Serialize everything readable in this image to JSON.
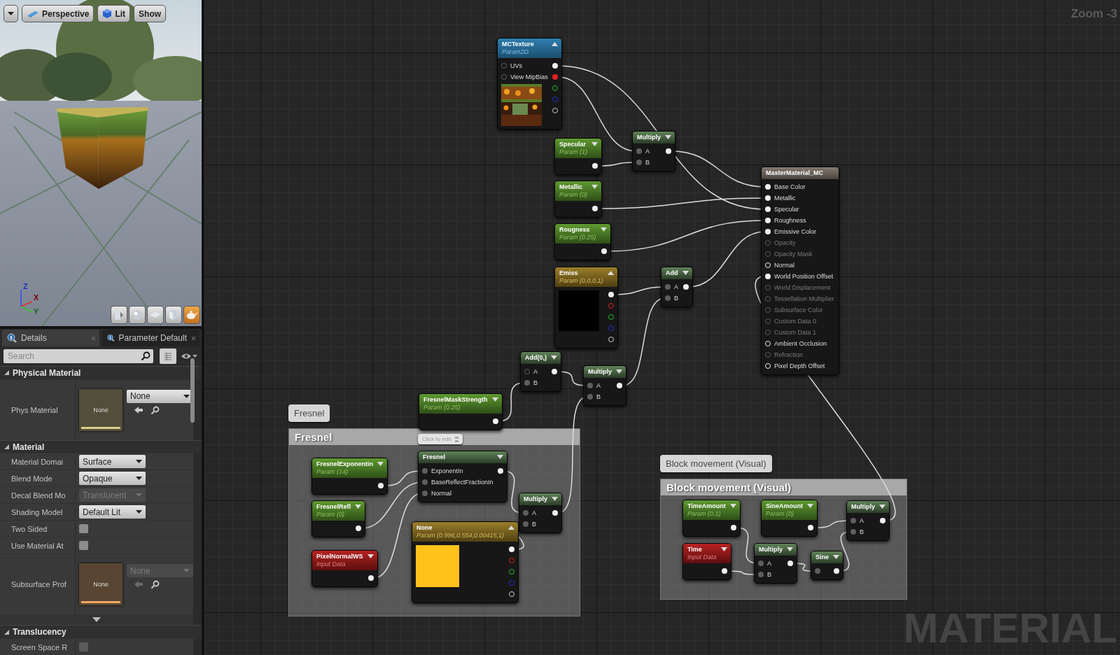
{
  "viewport": {
    "toolbar": [
      {
        "kind": "menu"
      },
      {
        "kind": "perspective",
        "label": "Perspective"
      },
      {
        "kind": "lit",
        "label": "Lit"
      },
      {
        "kind": "show",
        "label": "Show"
      }
    ],
    "axis_labels": [
      "Z",
      "X",
      "Y"
    ],
    "view_buttons": [
      {
        "kind": "cylinder",
        "selected": false
      },
      {
        "kind": "sphere",
        "selected": false
      },
      {
        "kind": "plane",
        "selected": false
      },
      {
        "kind": "cube",
        "selected": false
      },
      {
        "kind": "teapot",
        "selected": true
      }
    ]
  },
  "details": {
    "tabs": [
      {
        "label": "Details",
        "selected": true
      },
      {
        "label": "Parameter Default",
        "selected": false
      }
    ],
    "search": {
      "placeholder": "Search"
    },
    "sections": [
      {
        "title": "Physical Material",
        "expanded": true,
        "rows": [
          {
            "kind": "asset",
            "label": "Phys Material",
            "thumbnail": "None",
            "value": "None",
            "disabled": false,
            "color": "#d8cf8a"
          }
        ]
      },
      {
        "title": "Material",
        "expanded": true,
        "more": true,
        "rows": [
          {
            "kind": "combo",
            "label": "Material Domai",
            "value": "Surface",
            "disabled": false
          },
          {
            "kind": "combo",
            "label": "Blend Mode",
            "value": "Opaque",
            "disabled": false
          },
          {
            "kind": "combo",
            "label": "Decal Blend Mo",
            "value": "Translucent",
            "disabled": true
          },
          {
            "kind": "combo",
            "label": "Shading Model",
            "value": "Default Lit",
            "disabled": false
          },
          {
            "kind": "checkbox",
            "label": "Two Sided",
            "checked": false,
            "disabled": false
          },
          {
            "kind": "checkbox",
            "label": "Use Material At",
            "checked": false,
            "disabled": false
          },
          {
            "kind": "asset",
            "label": "Subsurface Prof",
            "thumbnail": "None",
            "value": "None",
            "disabled": true,
            "color": "#f2a864"
          }
        ]
      },
      {
        "title": "Translucency",
        "expanded": true,
        "rows": [
          {
            "kind": "checkbox",
            "label": "Screen Space R",
            "checked": false,
            "disabled": true
          }
        ]
      }
    ]
  },
  "graph": {
    "zoom": "Zoom -3",
    "label": "MATERIAL",
    "comments": [
      {
        "title": "Fresnel",
        "bubble": "Fresnel"
      },
      {
        "title": "Block movement (Visual)",
        "bubble": "Block movement (Visual)"
      }
    ],
    "nodes": [
      {
        "kind": "texture",
        "title": "MCTexture",
        "subtitle": "Param2D",
        "expanded": true,
        "inputs": [
          {
            "label": "UVs",
            "connected": false
          },
          {
            "label": "View MipBias",
            "connected": false
          }
        ],
        "outputs": [
          {
            "kind": "rgb",
            "connected": true
          },
          {
            "kind": "r",
            "connected": true
          },
          {
            "kind": "g",
            "connected": false
          },
          {
            "kind": "b",
            "connected": false
          },
          {
            "kind": "a",
            "connected": false
          }
        ]
      },
      {
        "kind": "param",
        "title": "Specular",
        "subtitle": "Param (1)",
        "expanded": false,
        "outputs": [
          {
            "kind": "rgb",
            "connected": true
          }
        ]
      },
      {
        "kind": "math",
        "title": "Multiply",
        "expanded": false,
        "inputs": [
          {
            "label": "A",
            "connected": true
          },
          {
            "label": "B",
            "connected": true
          }
        ],
        "outputs": [
          {
            "kind": "rgb",
            "connected": true
          }
        ]
      },
      {
        "kind": "result",
        "title": "MasterMaterial_MC",
        "inputs": [
          {
            "label": "Base Color",
            "enabled": true,
            "connected": true
          },
          {
            "label": "Metallic",
            "enabled": true,
            "connected": true
          },
          {
            "label": "Specular",
            "enabled": true,
            "connected": true
          },
          {
            "label": "Roughness",
            "enabled": true,
            "connected": true
          },
          {
            "label": "Emissive Color",
            "enabled": true,
            "connected": true
          },
          {
            "label": "Opacity",
            "enabled": false,
            "connected": false
          },
          {
            "label": "Opacity Mask",
            "enabled": false,
            "connected": false
          },
          {
            "label": "Normal",
            "enabled": true,
            "connected": false
          },
          {
            "label": "World Position Offset",
            "enabled": true,
            "connected": true
          },
          {
            "label": "World Displacement",
            "enabled": false,
            "connected": false
          },
          {
            "label": "Tessellation Multiplier",
            "enabled": false,
            "connected": false
          },
          {
            "label": "Subsurface Color",
            "enabled": false,
            "connected": false
          },
          {
            "label": "Custom Data 0",
            "enabled": false,
            "connected": false
          },
          {
            "label": "Custom Data 1",
            "enabled": false,
            "connected": false
          },
          {
            "label": "Ambient Occlusion",
            "enabled": true,
            "connected": false
          },
          {
            "label": "Refraction",
            "enabled": false,
            "connected": false
          },
          {
            "label": "Pixel Depth Offset",
            "enabled": true,
            "connected": false
          }
        ]
      },
      {
        "kind": "param",
        "title": "Metallic",
        "subtitle": "Param (0)",
        "expanded": false,
        "outputs": [
          {
            "kind": "rgb",
            "connected": true
          }
        ]
      },
      {
        "kind": "param",
        "title": "Rougness",
        "subtitle": "Param (0.25)",
        "expanded": false,
        "outputs": [
          {
            "kind": "rgb",
            "connected": true
          }
        ]
      },
      {
        "kind": "vector",
        "title": "Emiss",
        "subtitle": "Param (0,0,0,1)",
        "expanded": true,
        "color": "#000000",
        "outputs": [
          {
            "kind": "rgb",
            "connected": true
          },
          {
            "kind": "r",
            "connected": false
          },
          {
            "kind": "g",
            "connected": false
          },
          {
            "kind": "b",
            "connected": false
          },
          {
            "kind": "a",
            "connected": false
          }
        ]
      },
      {
        "kind": "math",
        "title": "Add",
        "expanded": false,
        "inputs": [
          {
            "label": "A",
            "connected": true
          },
          {
            "label": "B",
            "connected": true
          }
        ],
        "outputs": [
          {
            "kind": "rgb",
            "connected": true
          }
        ]
      },
      {
        "kind": "math",
        "title": "Add(0,)",
        "expanded": false,
        "inputs": [
          {
            "label": "A",
            "connected": false
          },
          {
            "label": "B",
            "connected": true
          }
        ],
        "outputs": [
          {
            "kind": "rgb",
            "connected": true
          }
        ]
      },
      {
        "kind": "math",
        "title": "Multiply",
        "expanded": false,
        "inputs": [
          {
            "label": "A",
            "connected": true
          },
          {
            "label": "B",
            "connected": true
          }
        ],
        "outputs": [
          {
            "kind": "rgb",
            "connected": true
          }
        ]
      },
      {
        "kind": "param",
        "title": "FresnelMaskStrength",
        "subtitle": "Param (0.25)",
        "expanded": false,
        "outputs": [
          {
            "kind": "rgb",
            "connected": true
          }
        ]
      },
      {
        "kind": "param",
        "title": "FresnelExponentin",
        "subtitle": "Param (14)",
        "expanded": false,
        "outputs": [
          {
            "kind": "rgb",
            "connected": true
          }
        ]
      },
      {
        "kind": "math",
        "title": "Fresnel",
        "expanded": false,
        "bubble": "Click to edit",
        "inputs": [
          {
            "label": "ExponentIn",
            "connected": true
          },
          {
            "label": "BaseReflectFractionIn",
            "connected": true
          },
          {
            "label": "Normal",
            "connected": true
          }
        ],
        "outputs": [
          {
            "kind": "rgb",
            "connected": true
          }
        ]
      },
      {
        "kind": "param",
        "title": "FresnelRefl",
        "subtitle": "Param (0)",
        "expanded": false,
        "outputs": [
          {
            "kind": "rgb",
            "connected": true
          }
        ]
      },
      {
        "kind": "math",
        "title": "Multiply",
        "expanded": false,
        "inputs": [
          {
            "label": "A",
            "connected": true
          },
          {
            "label": "B",
            "connected": true
          }
        ],
        "outputs": [
          {
            "kind": "rgb",
            "connected": true
          }
        ]
      },
      {
        "kind": "vector",
        "title": "None",
        "subtitle": "Param (0.996,0.554,0.00415,1)",
        "expanded": true,
        "color": "#fec21a",
        "outputs": [
          {
            "kind": "rgb",
            "connected": true
          },
          {
            "kind": "r",
            "connected": false
          },
          {
            "kind": "g",
            "connected": false
          },
          {
            "kind": "b",
            "connected": false
          },
          {
            "kind": "a",
            "connected": false
          }
        ]
      },
      {
        "kind": "input",
        "title": "PixelNormalWS",
        "subtitle": "Input Data",
        "expanded": false,
        "outputs": [
          {
            "kind": "rgb",
            "connected": true
          }
        ]
      },
      {
        "kind": "param",
        "title": "TimeAmount",
        "subtitle": "Param (0.1)",
        "expanded": false,
        "outputs": [
          {
            "kind": "rgb",
            "connected": true
          }
        ]
      },
      {
        "kind": "param",
        "title": "SineAmount",
        "subtitle": "Param (0)",
        "expanded": false,
        "outputs": [
          {
            "kind": "rgb",
            "connected": true
          }
        ]
      },
      {
        "kind": "math",
        "title": "Multiply",
        "expanded": false,
        "inputs": [
          {
            "label": "A",
            "connected": true
          },
          {
            "label": "B",
            "connected": true
          }
        ],
        "outputs": [
          {
            "kind": "rgb",
            "connected": true
          }
        ]
      },
      {
        "kind": "input",
        "title": "Time",
        "subtitle": "Input Data",
        "expanded": false,
        "outputs": [
          {
            "kind": "rgb",
            "connected": true
          }
        ]
      },
      {
        "kind": "math",
        "title": "Multiply",
        "expanded": false,
        "inputs": [
          {
            "label": "A",
            "connected": true
          },
          {
            "label": "B",
            "connected": true
          }
        ],
        "outputs": [
          {
            "kind": "rgb",
            "connected": true
          }
        ]
      },
      {
        "kind": "math",
        "title": "Sine",
        "expanded": false,
        "inputs": [
          {
            "connected": true
          }
        ],
        "outputs": [
          {
            "kind": "rgb",
            "connected": true
          }
        ]
      }
    ]
  }
}
